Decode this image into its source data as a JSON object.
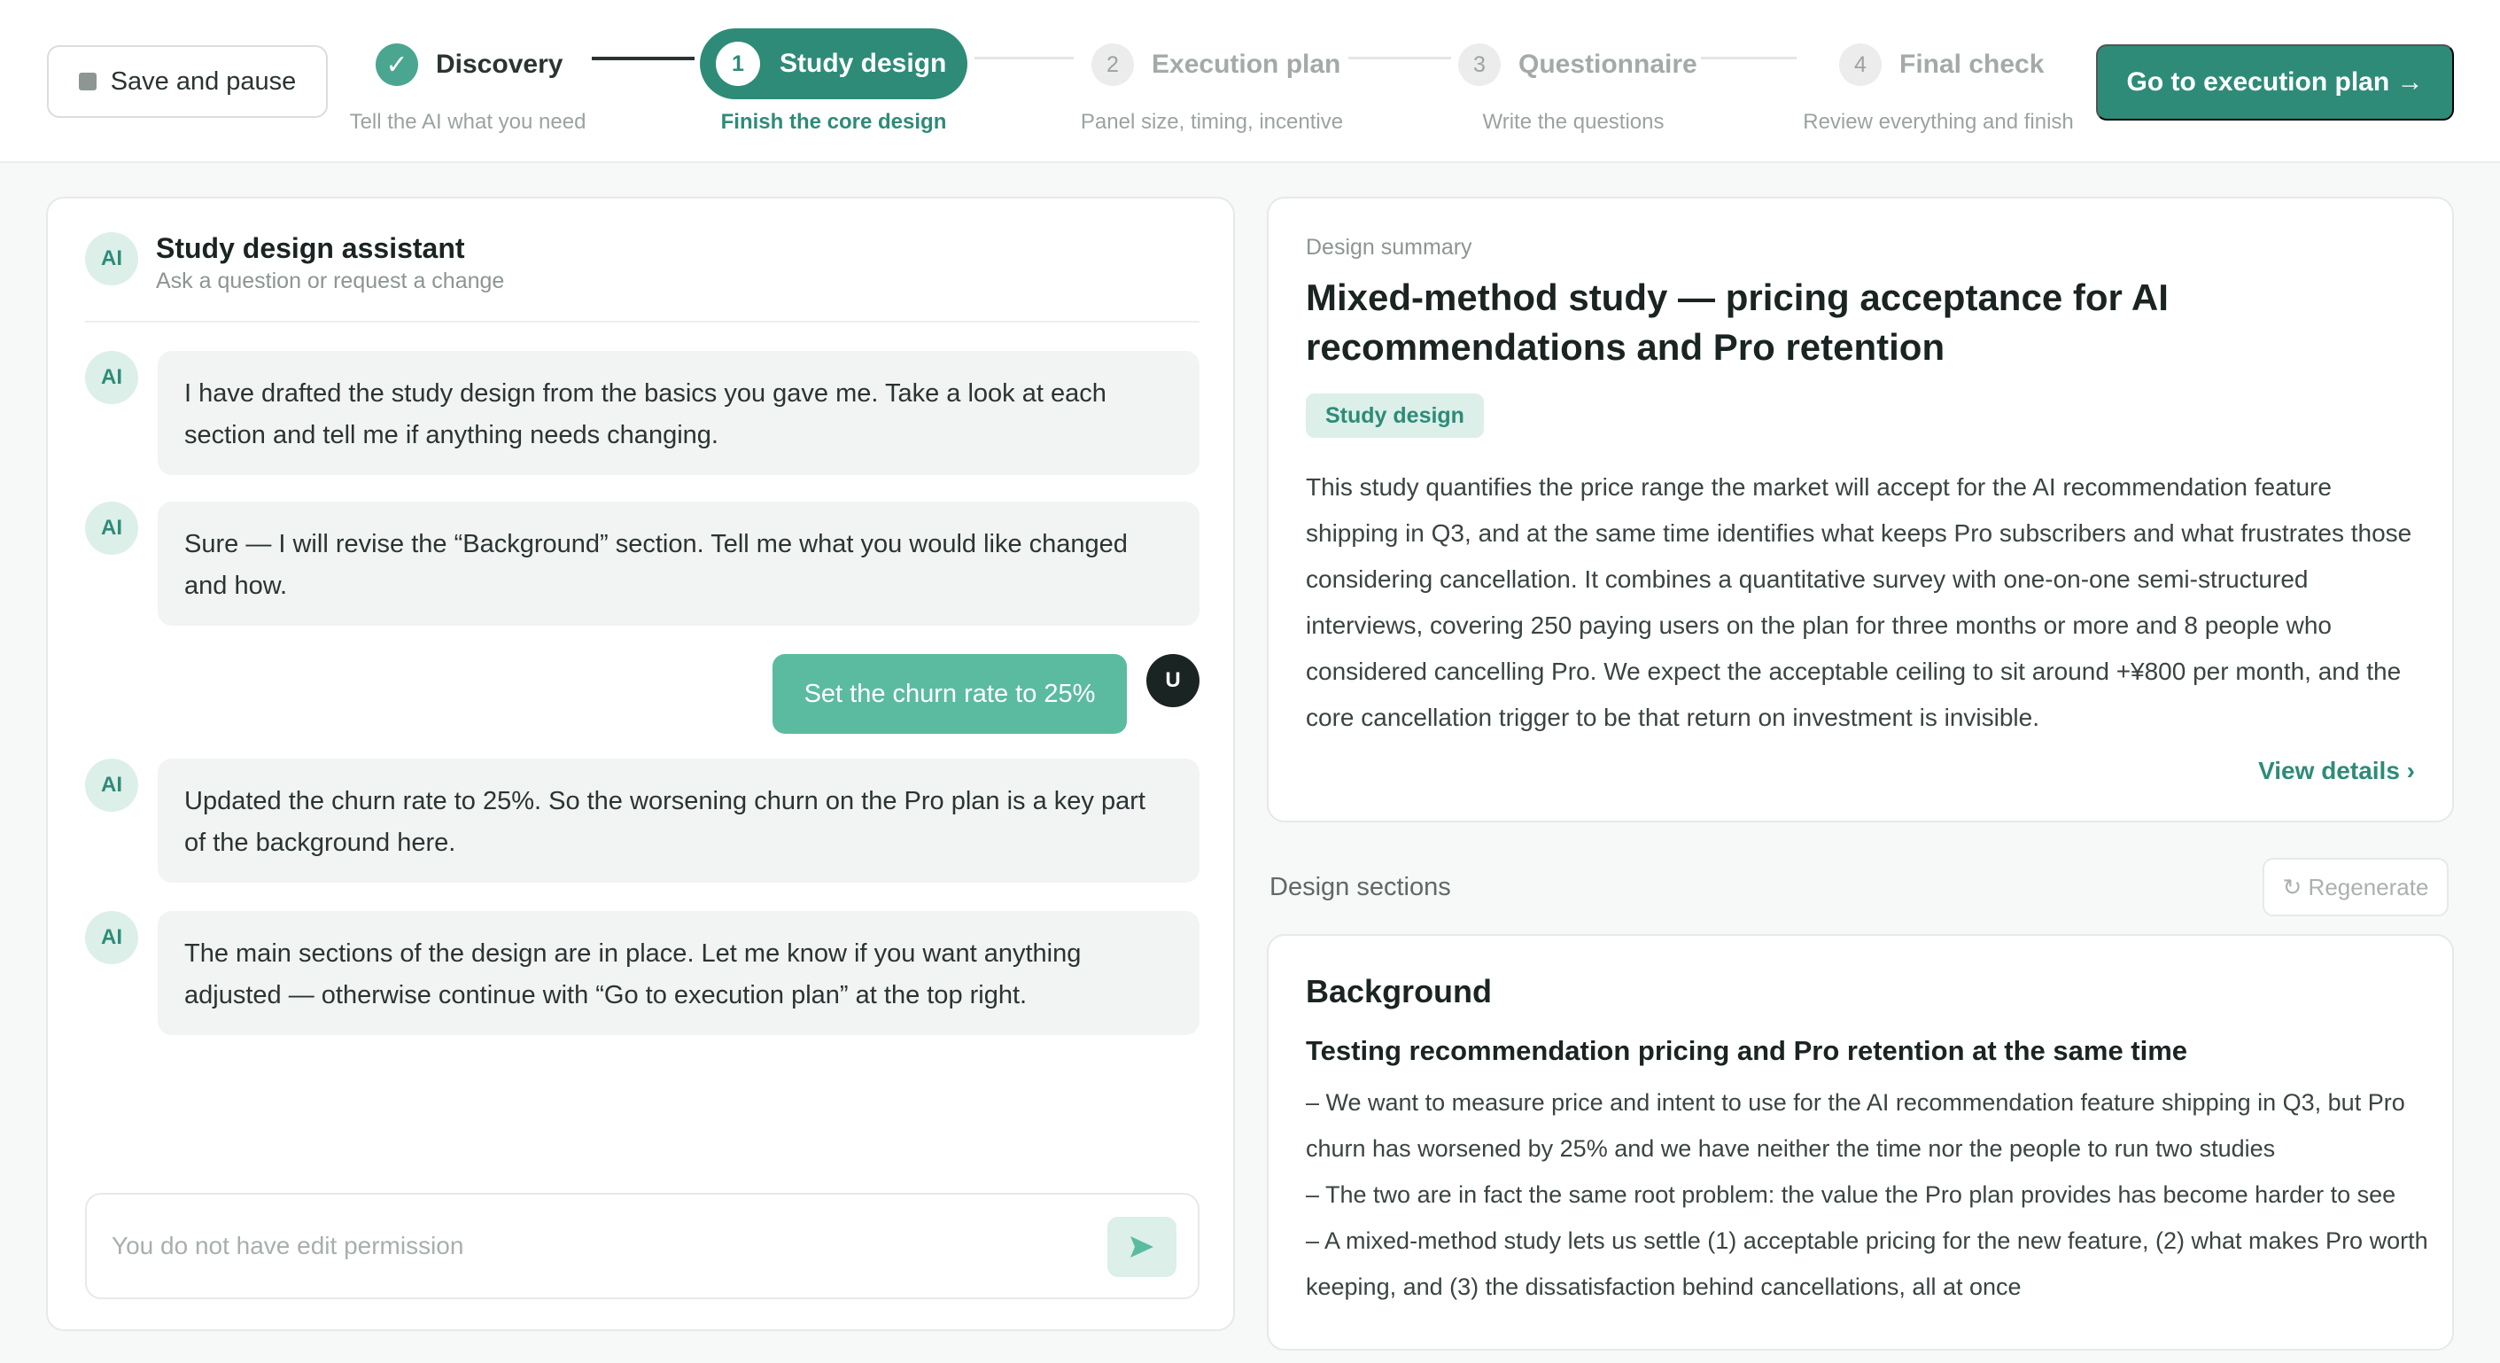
{
  "header": {
    "save_label": "Save and pause",
    "cta_label": "Go to execution plan →",
    "steps": [
      {
        "number": "",
        "label": "Discovery",
        "sub": "Tell the AI what you need",
        "status": "done"
      },
      {
        "number": "1",
        "label": "Study design",
        "sub": "Finish the core design",
        "status": "active"
      },
      {
        "number": "2",
        "label": "Execution plan",
        "sub": "Panel size, timing, incentive",
        "status": "todo"
      },
      {
        "number": "3",
        "label": "Questionnaire",
        "sub": "Write the questions",
        "status": "todo"
      },
      {
        "number": "4",
        "label": "Final check",
        "sub": "Review everything and finish",
        "status": "todo"
      }
    ]
  },
  "chat": {
    "title": "Study design assistant",
    "subtitle": "Ask a question or request a change",
    "avatar_label": "AI",
    "user_avatar_label": "U",
    "messages": [
      {
        "role": "ai",
        "text": "I have drafted the study design from the basics you gave me. Take a look at each section and tell me if anything needs changing."
      },
      {
        "role": "ai",
        "text": "Sure — I will revise the “Background” section. Tell me what you would like changed and how."
      },
      {
        "role": "user",
        "text": "Set the churn rate to 25%"
      },
      {
        "role": "ai",
        "text": "Updated the churn rate to 25%. So the worsening churn on the Pro plan is a key part of the background here."
      },
      {
        "role": "ai",
        "text": "The main sections of the design are in place. Let me know if you want anything adjusted — otherwise continue with “Go to execution plan” at the top right."
      }
    ],
    "input_placeholder": "You do not have edit permission"
  },
  "summary": {
    "eyebrow": "Design summary",
    "title": "Mixed-method study — pricing acceptance for AI recommendations and Pro retention",
    "tag": "Study design",
    "body": "This study quantifies the price range the market will accept for the AI recommendation feature shipping in Q3, and at the same time identifies what keeps Pro subscribers and what frustrates those considering cancellation. It combines a quantitative survey with one-on-one semi-structured interviews, covering 250 paying users on the plan for three months or more and 8 people who considered cancelling Pro. We expect the acceptable ceiling to sit around +¥800 per month, and the core cancellation trigger to be that return on investment is invisible.",
    "view_details": "View details ›"
  },
  "sections": {
    "label": "Design sections",
    "regenerate_label": "↻ Regenerate",
    "items": [
      {
        "title": "Background",
        "subtitle": "Testing recommendation pricing and Pro retention at the same time",
        "bullets": [
          "– We want to measure price and intent to use for the AI recommendation feature shipping in Q3, but Pro churn has worsened by 25% and we have neither the time nor the people to run two studies",
          "– The two are in fact the same root problem: the value the Pro plan provides has become harder to see",
          "– A mixed-method study lets us settle (1) acceptable pricing for the new feature, (2) what makes Pro worth keeping, and (3) the dissatisfaction behind cancellations, all at once"
        ]
      }
    ]
  },
  "colors": {
    "accent": "#2e8b78",
    "accent_light": "#dcefe9",
    "user_bubble": "#5bbba0"
  },
  "icons": {
    "save": "stop-square-icon",
    "check": "check-icon",
    "send": "send-arrow-icon",
    "regenerate": "refresh-icon"
  }
}
